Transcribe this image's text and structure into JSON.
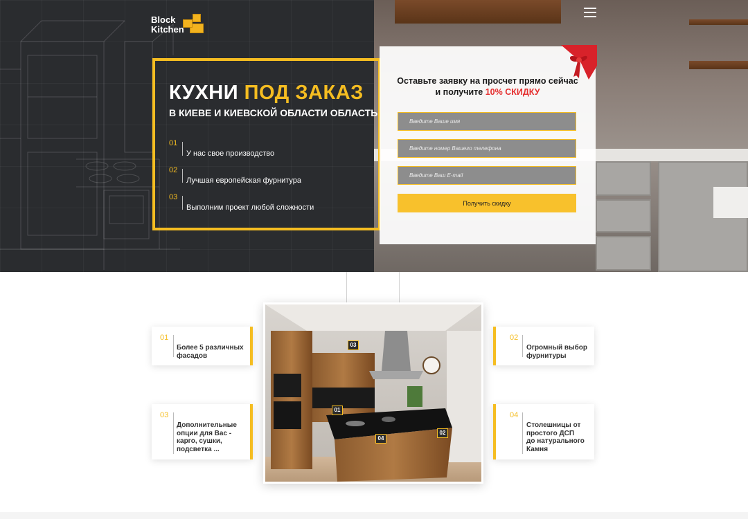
{
  "brand": {
    "line1": "Block",
    "line2": "Kitchen",
    "accent": "#f5bd21",
    "dark": "#2a2c2f"
  },
  "hero": {
    "title_white": "КУХНИ",
    "title_yellow": "ПОД ЗАКАЗ",
    "subtitle": "В КИЕВЕ И  КИЕВСКОЙ ОБЛАСТИ ОБЛАСТЬ",
    "features": [
      {
        "num": "01",
        "text": "У нас свое производство"
      },
      {
        "num": "02",
        "text": "Лучшая европейская фурнитура"
      },
      {
        "num": "03",
        "text": "Выполним проект любой сложности"
      }
    ]
  },
  "form": {
    "heading_line1": "Оставьте заявку на просчет прямо сейчас",
    "heading_line2_prefix": "и получите ",
    "heading_line2_highlight": "10% СКИДКУ",
    "name_placeholder": "Введите Ваше имя",
    "phone_placeholder": "Введите номер Вашего телефона",
    "email_placeholder": "Введите Ваш E-mail",
    "submit_label": "Получить скидку"
  },
  "markers": [
    "01",
    "02",
    "03",
    "04"
  ],
  "cards": [
    {
      "num": "01",
      "text": "Более 5 различных фасадов"
    },
    {
      "num": "02",
      "text": "Огромный выбор фурнитуры"
    },
    {
      "num": "03",
      "text": "Дополнительные опции для Вас - карго, сушки, подсветка ..."
    },
    {
      "num": "04",
      "text": "Столешницы от простого ДСП до натурального Камня"
    }
  ]
}
